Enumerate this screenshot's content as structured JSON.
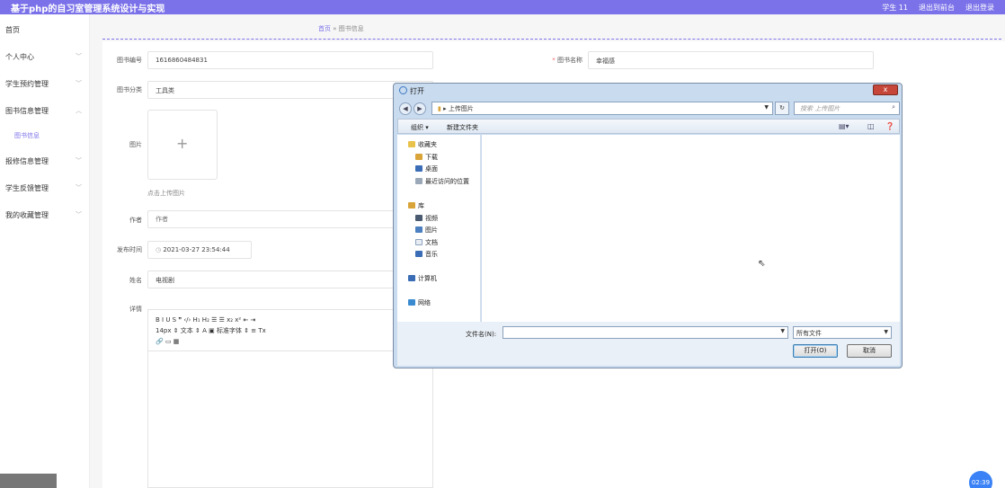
{
  "header": {
    "title": "基于php的自习室管理系统设计与实现",
    "user": "学生 11",
    "to_frontend": "退出到前台",
    "logout": "退出登录"
  },
  "sidebar": {
    "items": [
      {
        "label": "首页"
      },
      {
        "label": "个人中心"
      },
      {
        "label": "学生预约管理"
      },
      {
        "label": "图书信息管理"
      },
      {
        "label": "图书信息"
      },
      {
        "label": "报修信息管理"
      },
      {
        "label": "学生反馈管理"
      },
      {
        "label": "我的收藏管理"
      }
    ]
  },
  "breadcrumb": {
    "home": "首页",
    "sep": "»",
    "current": "图书信息"
  },
  "form": {
    "book_no_label": "图书编号",
    "book_no_value": "1616860484831",
    "book_name_label": "图书名称",
    "book_name_value": "幸福感",
    "category_label": "图书分类",
    "category_value": "工具类",
    "image_label": "图片",
    "upload_hint": "点击上传图片",
    "author_label": "作者",
    "author_placeholder": "作者",
    "publish_label": "发布时间",
    "publish_value": "2021-03-27 23:54:44",
    "name_label": "姓名",
    "name_value": "电视剧",
    "detail_label": "详情"
  },
  "editor": {
    "row1": "B  I  U  S    ❞  ‹/›   H₁  H₂   ☰  ☰    x₂  x²    ⇤  ⇥",
    "row2": "14px        ⇕      文本        ⇕    A   ▣     标准字体      ⇕     ≡     Tx",
    "row3": "🔗  ▭  ▦"
  },
  "dialog": {
    "title": "打开",
    "close": "x",
    "path": "上传图片",
    "search_placeholder": "搜索 上传图片",
    "organize": "组织 ▾",
    "new_folder": "新建文件夹",
    "nav": [
      {
        "label": "收藏夹"
      },
      {
        "label": "下载"
      },
      {
        "label": "桌面"
      },
      {
        "label": "最近访问的位置"
      },
      {
        "label": "库"
      },
      {
        "label": "视频"
      },
      {
        "label": "图片"
      },
      {
        "label": "文档"
      },
      {
        "label": "音乐"
      },
      {
        "label": "计算机"
      },
      {
        "label": "网络"
      }
    ],
    "filename_label": "文件名(N):",
    "filter": "所有文件",
    "open": "打开(O)",
    "cancel": "取消"
  },
  "clock": "02:39"
}
